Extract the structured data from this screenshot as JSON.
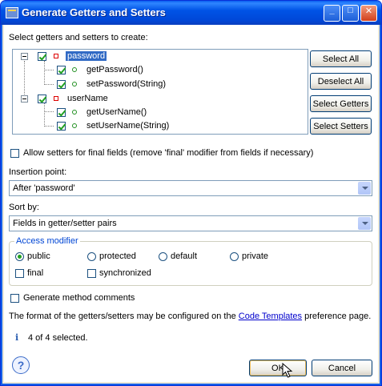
{
  "window": {
    "title": "Generate Getters and Setters",
    "buttons": {
      "minimize": "_",
      "maximize": "□",
      "close": "✕"
    }
  },
  "select_label": "Select getters and setters to create:",
  "tree": {
    "fields": [
      {
        "name": "password",
        "checked": true,
        "selected": true,
        "methods": [
          {
            "name": "getPassword()",
            "checked": true
          },
          {
            "name": "setPassword(String)",
            "checked": true
          }
        ]
      },
      {
        "name": "userName",
        "checked": true,
        "selected": false,
        "methods": [
          {
            "name": "getUserName()",
            "checked": true
          },
          {
            "name": "setUserName(String)",
            "checked": true
          }
        ]
      }
    ]
  },
  "side_buttons": {
    "select_all": "Select All",
    "deselect_all": "Deselect All",
    "select_getters": "Select Getters",
    "select_setters": "Select Setters"
  },
  "allow_setters_label": "Allow setters for final fields (remove 'final' modifier from fields if necessary)",
  "insertion_point": {
    "label": "Insertion point:",
    "value": "After 'password'"
  },
  "sort_by": {
    "label": "Sort by:",
    "value": "Fields in getter/setter pairs"
  },
  "access_modifier": {
    "legend": "Access modifier",
    "options": [
      "public",
      "protected",
      "default",
      "private"
    ],
    "selected": "public",
    "final_label": "final",
    "synchronized_label": "synchronized"
  },
  "generate_comments_label": "Generate method comments",
  "info_text": {
    "before": "The format of the getters/setters may be configured on the ",
    "link": "Code Templates",
    "after": " preference page."
  },
  "status": {
    "icon": "i",
    "text": "4 of 4 selected."
  },
  "footer": {
    "ok": "OK",
    "cancel": "Cancel",
    "help_icon": "?"
  },
  "colors": {
    "title_bar": "#0053e6",
    "selection": "#316ac5",
    "link": "#0000cc"
  }
}
